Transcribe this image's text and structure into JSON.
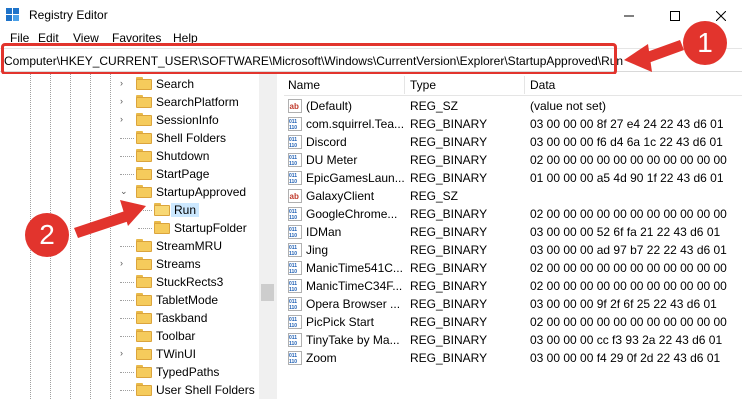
{
  "window": {
    "title": "Registry Editor",
    "controls": {
      "minimize": "—",
      "maximize": "☐",
      "close": "✕"
    }
  },
  "menu": [
    "File",
    "Edit",
    "View",
    "Favorites",
    "Help"
  ],
  "address": {
    "path": "Computer\\HKEY_CURRENT_USER\\SOFTWARE\\Microsoft\\Windows\\CurrentVersion\\Explorer\\StartupApproved\\Run"
  },
  "tree": {
    "items": [
      {
        "label": "Search",
        "level": 0,
        "expander": "›"
      },
      {
        "label": "SearchPlatform",
        "level": 0,
        "expander": "›"
      },
      {
        "label": "SessionInfo",
        "level": 0,
        "expander": "›"
      },
      {
        "label": "Shell Folders",
        "level": 0,
        "expander": ""
      },
      {
        "label": "Shutdown",
        "level": 0,
        "expander": ""
      },
      {
        "label": "StartPage",
        "level": 0,
        "expander": ""
      },
      {
        "label": "StartupApproved",
        "level": 0,
        "expander": "⌄"
      },
      {
        "label": "Run",
        "level": 1,
        "expander": "",
        "selected": true
      },
      {
        "label": "StartupFolder",
        "level": 1,
        "expander": ""
      },
      {
        "label": "StreamMRU",
        "level": 0,
        "expander": ""
      },
      {
        "label": "Streams",
        "level": 0,
        "expander": "›"
      },
      {
        "label": "StuckRects3",
        "level": 0,
        "expander": ""
      },
      {
        "label": "TabletMode",
        "level": 0,
        "expander": ""
      },
      {
        "label": "Taskband",
        "level": 0,
        "expander": ""
      },
      {
        "label": "Toolbar",
        "level": 0,
        "expander": ""
      },
      {
        "label": "TWinUI",
        "level": 0,
        "expander": "›"
      },
      {
        "label": "TypedPaths",
        "level": 0,
        "expander": ""
      },
      {
        "label": "User Shell Folders",
        "level": 0,
        "expander": ""
      }
    ]
  },
  "list": {
    "columns": [
      "Name",
      "Type",
      "Data"
    ],
    "rows": [
      {
        "icon": "ab",
        "name": "(Default)",
        "type": "REG_SZ",
        "data": "(value not set)"
      },
      {
        "icon": "bin",
        "name": "com.squirrel.Tea...",
        "type": "REG_BINARY",
        "data": "03 00 00 00 8f 27 e4 24 22 43 d6 01"
      },
      {
        "icon": "bin",
        "name": "Discord",
        "type": "REG_BINARY",
        "data": "03 00 00 00 f6 d4 6a 1c 22 43 d6 01"
      },
      {
        "icon": "bin",
        "name": "DU Meter",
        "type": "REG_BINARY",
        "data": "02 00 00 00 00 00 00 00 00 00 00 00"
      },
      {
        "icon": "bin",
        "name": "EpicGamesLaun...",
        "type": "REG_BINARY",
        "data": "01 00 00 00 a5 4d 90 1f 22 43 d6 01"
      },
      {
        "icon": "ab",
        "name": "GalaxyClient",
        "type": "REG_SZ",
        "data": ""
      },
      {
        "icon": "bin",
        "name": "GoogleChrome...",
        "type": "REG_BINARY",
        "data": "02 00 00 00 00 00 00 00 00 00 00 00"
      },
      {
        "icon": "bin",
        "name": "IDMan",
        "type": "REG_BINARY",
        "data": "03 00 00 00 52 6f fa 21 22 43 d6 01"
      },
      {
        "icon": "bin",
        "name": "Jing",
        "type": "REG_BINARY",
        "data": "03 00 00 00 ad 97 b7 22 22 43 d6 01"
      },
      {
        "icon": "bin",
        "name": "ManicTime541C...",
        "type": "REG_BINARY",
        "data": "02 00 00 00 00 00 00 00 00 00 00 00"
      },
      {
        "icon": "bin",
        "name": "ManicTimeC34F...",
        "type": "REG_BINARY",
        "data": "02 00 00 00 00 00 00 00 00 00 00 00"
      },
      {
        "icon": "bin",
        "name": "Opera Browser ...",
        "type": "REG_BINARY",
        "data": "03 00 00 00 9f 2f 6f 25 22 43 d6 01"
      },
      {
        "icon": "bin",
        "name": "PicPick Start",
        "type": "REG_BINARY",
        "data": "02 00 00 00 00 00 00 00 00 00 00 00"
      },
      {
        "icon": "bin",
        "name": "TinyTake by Ma...",
        "type": "REG_BINARY",
        "data": "03 00 00 00 cc f3 93 2a 22 43 d6 01"
      },
      {
        "icon": "bin",
        "name": "Zoom",
        "type": "REG_BINARY",
        "data": "03 00 00 00 f4 29 0f 2d 22 43 d6 01"
      }
    ]
  },
  "annotations": {
    "badge1": "1",
    "badge2": "2",
    "color": "#e2342d"
  }
}
